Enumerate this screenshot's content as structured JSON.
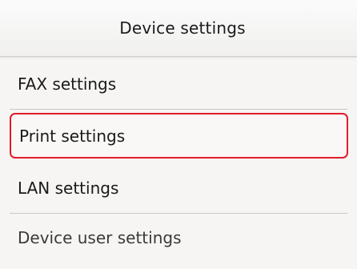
{
  "header": {
    "title": "Device settings"
  },
  "menu": {
    "items": [
      {
        "label": "FAX settings"
      },
      {
        "label": "Print settings",
        "selected": true
      },
      {
        "label": "LAN settings"
      },
      {
        "label": "Device user settings"
      }
    ]
  },
  "colors": {
    "selection_border": "#e31b2a",
    "background": "#f6f5f4"
  }
}
